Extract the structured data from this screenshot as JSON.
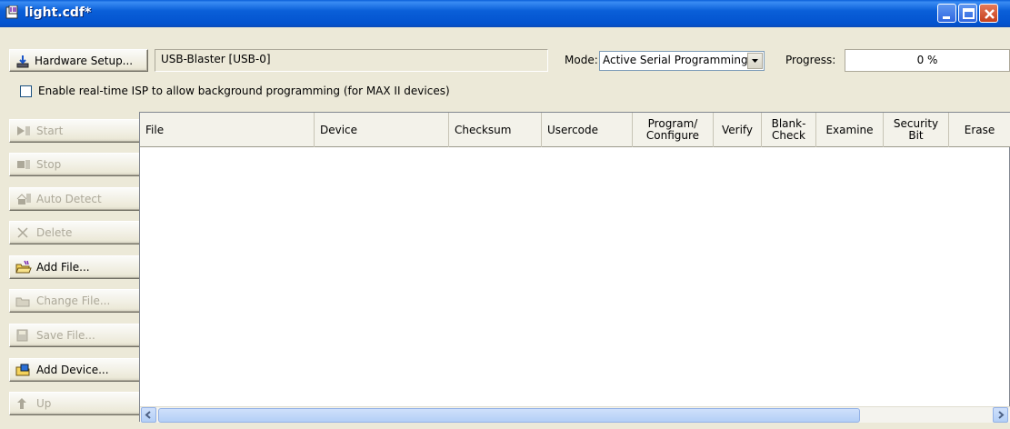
{
  "window": {
    "title": "light.cdf*"
  },
  "toolbar": {
    "hardware_setup_label": "Hardware Setup...",
    "hardware_value": "USB-Blaster [USB-0]",
    "mode_label": "Mode:",
    "mode_value": "Active Serial Programming",
    "progress_label": "Progress:",
    "progress_value": "0 %"
  },
  "isp": {
    "label": "Enable real-time ISP to allow background programming (for MAX II devices)",
    "checked": false
  },
  "side_buttons": [
    {
      "label": "Start",
      "enabled": false,
      "icon": "start-icon"
    },
    {
      "label": "Stop",
      "enabled": false,
      "icon": "stop-icon"
    },
    {
      "label": "Auto Detect",
      "enabled": false,
      "icon": "auto-detect-icon"
    },
    {
      "label": "Delete",
      "enabled": false,
      "icon": "delete-icon"
    },
    {
      "label": "Add File...",
      "enabled": true,
      "icon": "add-file-icon"
    },
    {
      "label": "Change File...",
      "enabled": false,
      "icon": "change-file-icon"
    },
    {
      "label": "Save File...",
      "enabled": false,
      "icon": "save-file-icon"
    },
    {
      "label": "Add Device...",
      "enabled": true,
      "icon": "add-device-icon"
    },
    {
      "label": "Up",
      "enabled": false,
      "icon": "up-icon"
    }
  ],
  "table": {
    "columns": [
      {
        "line1": "File",
        "line2": ""
      },
      {
        "line1": "Device",
        "line2": ""
      },
      {
        "line1": "Checksum",
        "line2": ""
      },
      {
        "line1": "Usercode",
        "line2": ""
      },
      {
        "line1": "Program/",
        "line2": "Configure"
      },
      {
        "line1": "Verify",
        "line2": ""
      },
      {
        "line1": "Blank-",
        "line2": "Check"
      },
      {
        "line1": "Examine",
        "line2": ""
      },
      {
        "line1": "Security",
        "line2": "Bit"
      },
      {
        "line1": "Erase",
        "line2": ""
      }
    ],
    "rows": []
  },
  "colors": {
    "title_bar": "#0a5fd8",
    "window_bg": "#ece9d8",
    "disabled_text": "#aca899"
  }
}
